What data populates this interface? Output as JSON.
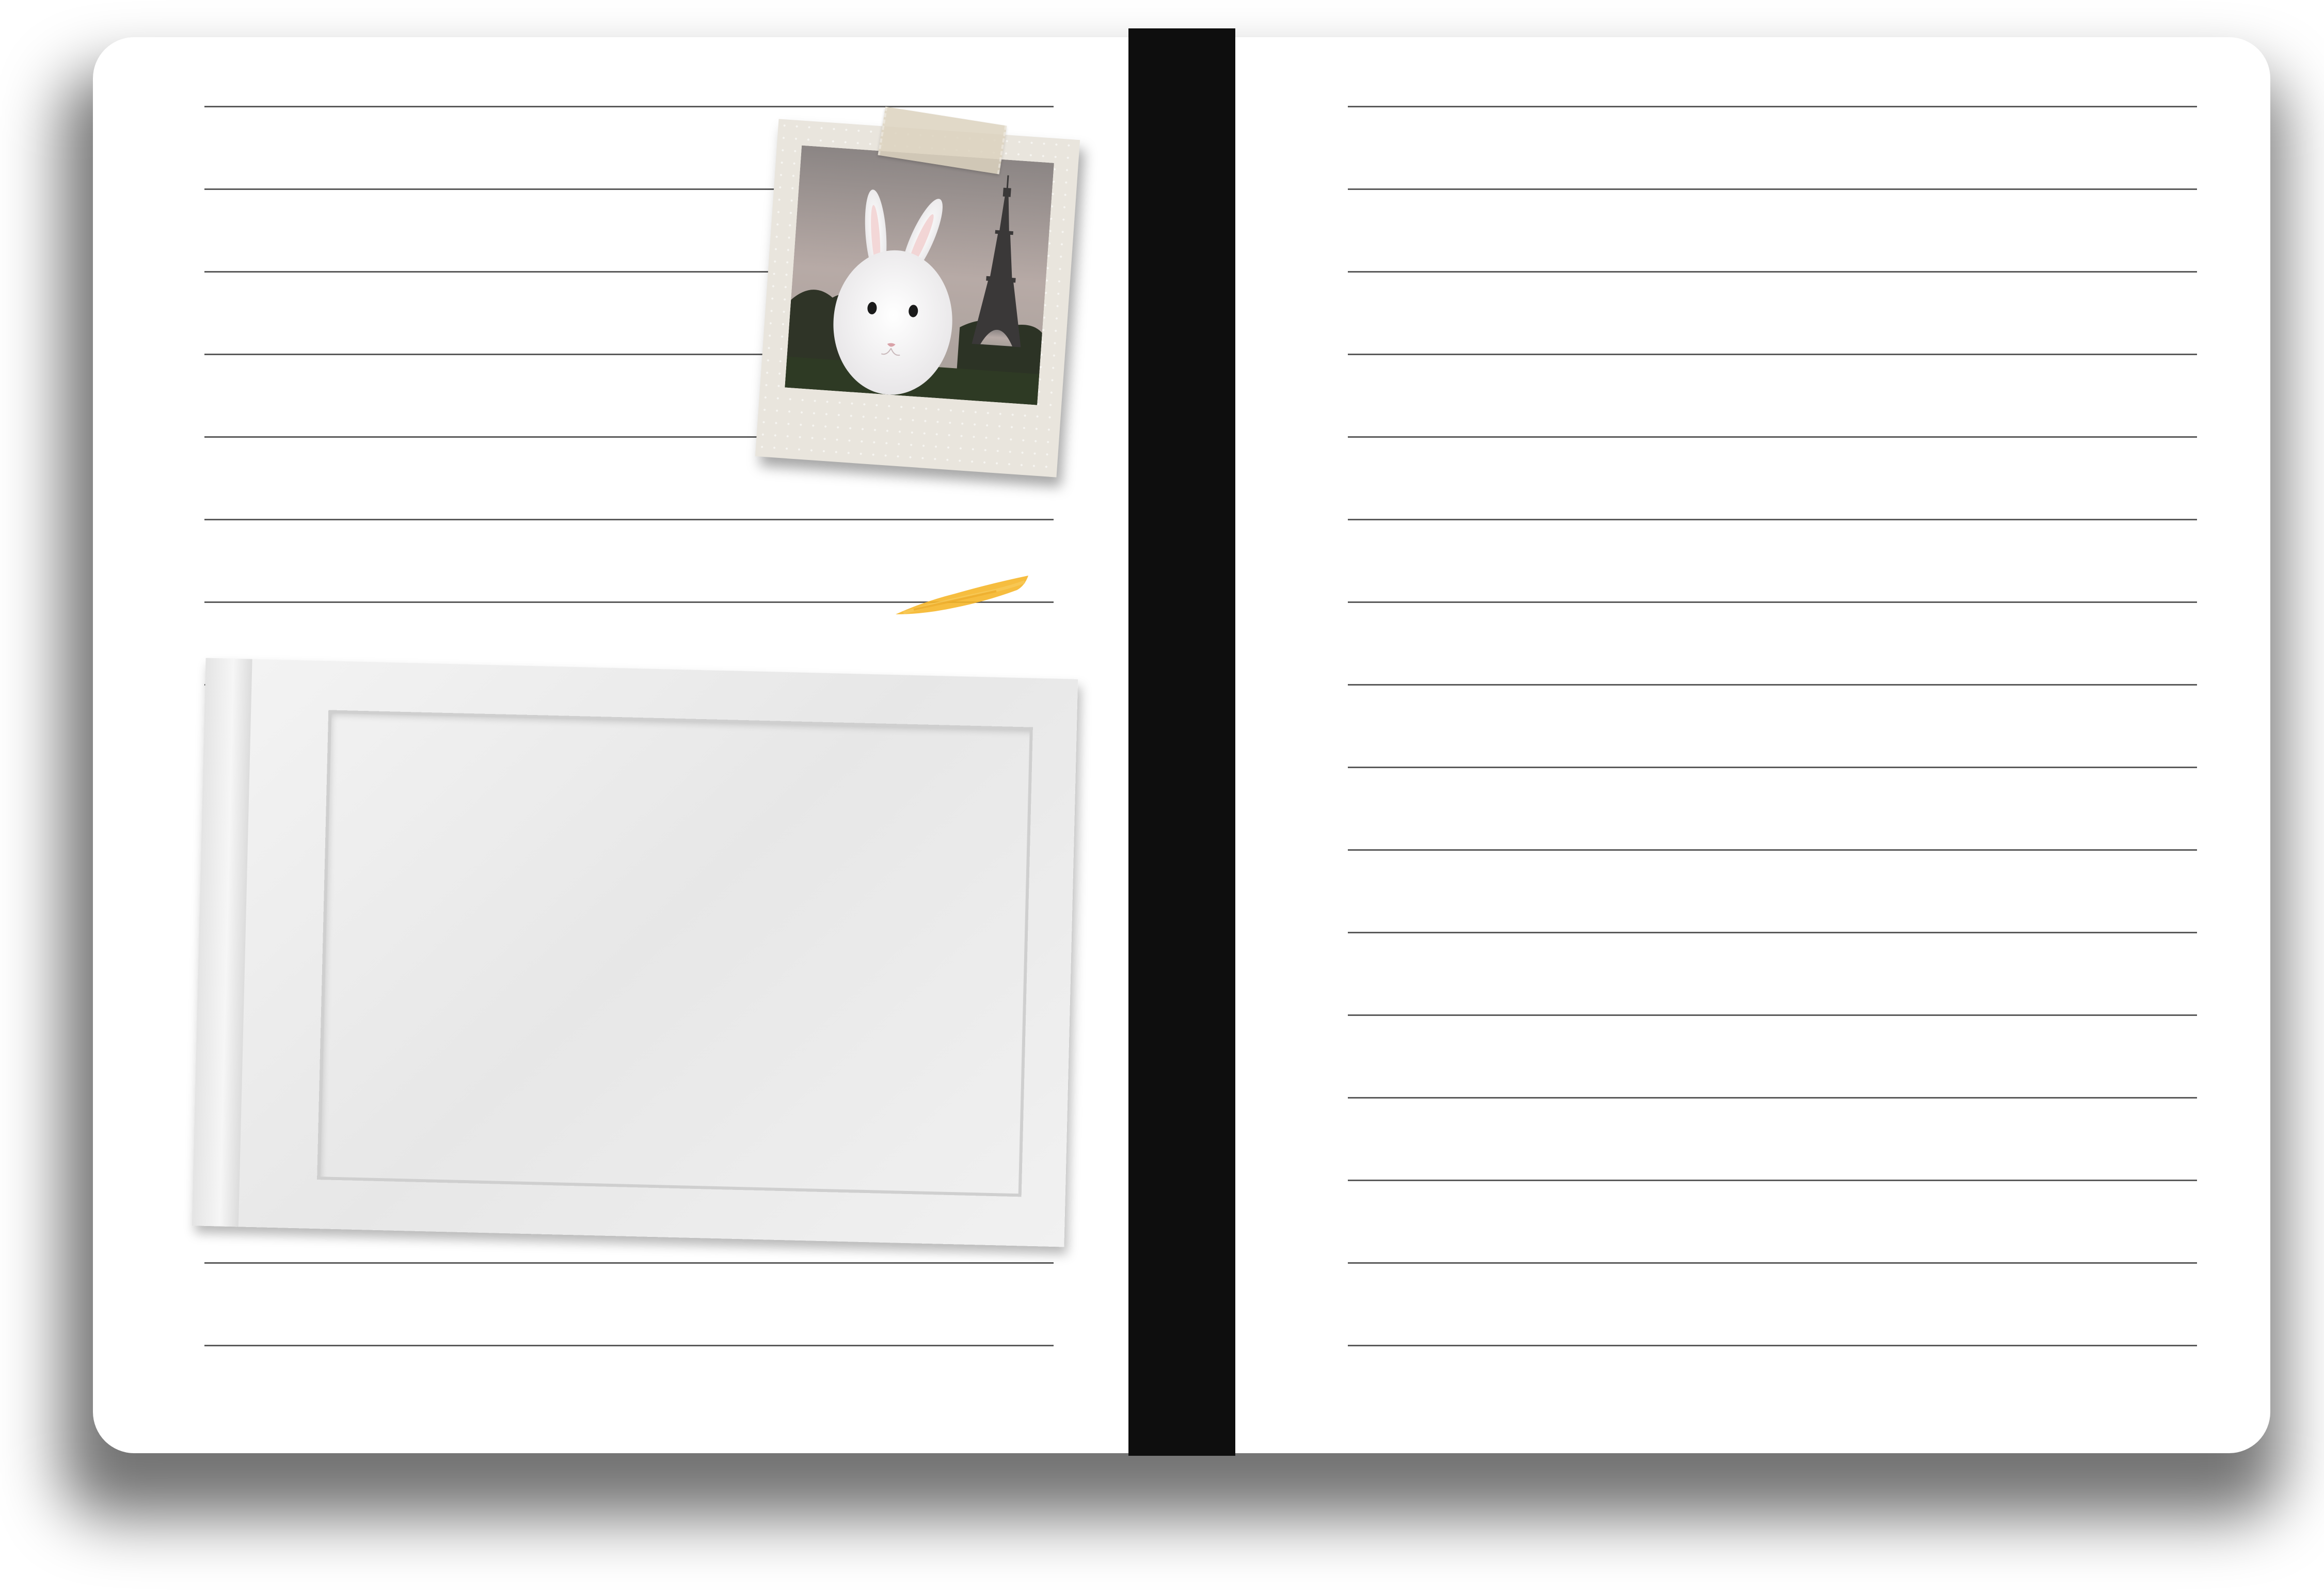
{
  "scene": {
    "description_label": "",
    "colors": {
      "paper": "#ffffff",
      "rule_lines": "#5a5a5a",
      "strap": "#0e0e0e",
      "brush_accent": "#f5b62a",
      "polaroid_border": "#e9e5dd",
      "frame": "#eeeeee"
    },
    "left_page": {
      "rule_count": 16
    },
    "right_page": {
      "rule_count": 16
    },
    "polaroid": {
      "icon": "bunny-eiffel-photo"
    },
    "frame": {
      "icon": "empty-photo-frame"
    },
    "brush": {
      "icon": "yellow-brush-stroke"
    }
  }
}
